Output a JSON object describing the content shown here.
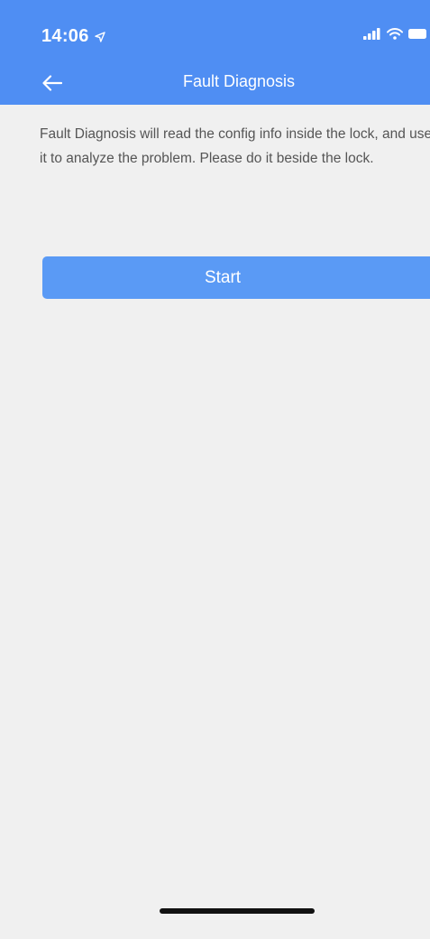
{
  "status_bar": {
    "time": "14:06",
    "location_icon": "location-arrow-icon",
    "signal_icon": "cellular-signal-icon",
    "wifi_icon": "wifi-icon",
    "battery_icon": "battery-icon"
  },
  "nav": {
    "title": "Fault Diagnosis",
    "back_icon": "back-arrow-icon"
  },
  "main": {
    "description": "Fault Diagnosis will read the config info inside the lock, and use it to analyze the problem. Please do it beside the lock.",
    "start_label": "Start"
  },
  "colors": {
    "header_bg": "#4f8ef3",
    "button_bg": "#5a9af5",
    "page_bg": "#f0f0f0",
    "text": "#555555"
  }
}
